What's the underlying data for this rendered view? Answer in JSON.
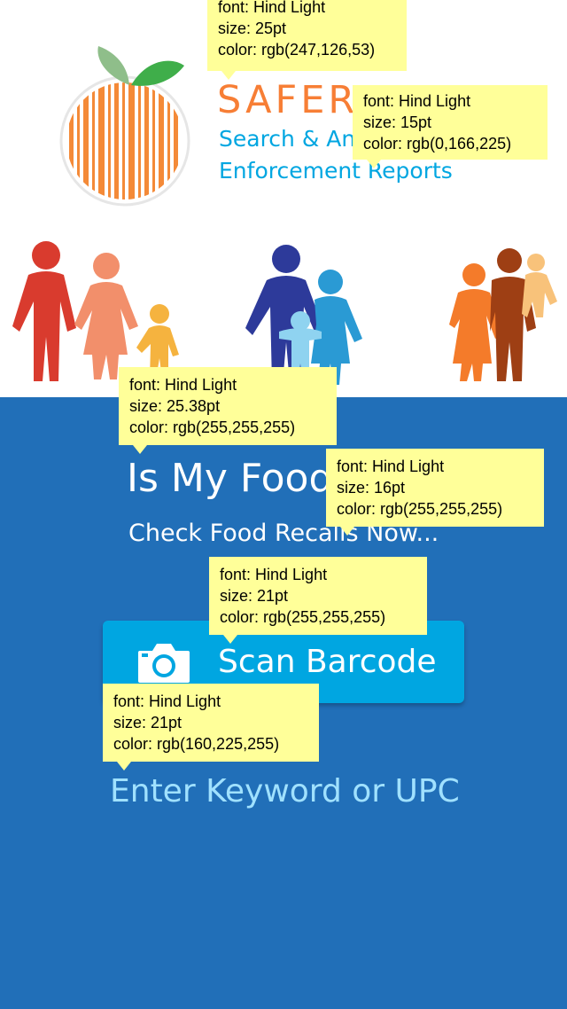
{
  "header": {
    "brand_title": "SAFER",
    "brand_subtitle": "Search & Analyze Enforcement Reports"
  },
  "hero": {
    "headline": "Is My Food",
    "subline": "Check Food Recalls Now..."
  },
  "scan_button": {
    "label": "Scan Barcode",
    "icon": "camera-icon"
  },
  "search": {
    "placeholder": "Enter Keyword or UPC",
    "value": ""
  },
  "annotations": [
    {
      "font": "font: Hind Light",
      "size": "size: 25pt",
      "color": "color: rgb(247,126,53)"
    },
    {
      "font": "font: Hind Light",
      "size": "size: 15pt",
      "color": "color: rgb(0,166,225)"
    },
    {
      "font": "font: Hind Light",
      "size": "size: 25.38pt",
      "color": "color: rgb(255,255,255)"
    },
    {
      "font": "font: Hind Light",
      "size": "size: 16pt",
      "color": "color: rgb(255,255,255)"
    },
    {
      "font": "font: Hind Light",
      "size": "size: 21pt",
      "color": "color: rgb(255,255,255)"
    },
    {
      "font": "font: Hind Light",
      "size": "size: 21pt",
      "color": "color: rgb(160,225,255)"
    }
  ],
  "colors": {
    "brand_orange": "#f77e35",
    "brand_blue": "#00a6e1",
    "panel_blue": "#216fb8",
    "placeholder_blue": "#a0e1ff",
    "annotation_yellow": "#ffff99"
  }
}
